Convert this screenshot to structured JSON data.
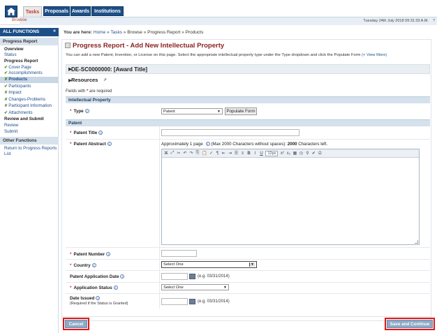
{
  "header": {
    "tabs": [
      {
        "label": "Tasks"
      },
      {
        "label": "Proposals"
      },
      {
        "label": "Awards"
      },
      {
        "label": "Institutions"
      }
    ],
    "subnav": "Browse",
    "date": "Tuesday 24th July 2018 09:31:33 A.M.",
    "help": "?"
  },
  "sidebar": {
    "title": "ALL FUNCTIONS",
    "collapse": "«",
    "section1": "Progress Report",
    "overview": "Overview",
    "status": "Status",
    "progress_report": "Progress Report",
    "items": [
      {
        "label": "Cover Page",
        "mark": "✔"
      },
      {
        "label": "Accomplishments",
        "mark": "✔"
      },
      {
        "label": "Products",
        "mark": "✘"
      },
      {
        "label": "Participants",
        "mark": "✔"
      },
      {
        "label": "Impact",
        "mark": "✘"
      },
      {
        "label": "Changes-Problems",
        "mark": "✘"
      },
      {
        "label": "Participant Information",
        "mark": "✘"
      },
      {
        "label": "Attachments",
        "mark": "✔"
      }
    ],
    "review_submit": "Review and Submit",
    "review": "Review",
    "submit": "Submit",
    "section2": "Other Functions",
    "other_items": [
      "Return to Progress Reports",
      "List"
    ]
  },
  "breadcrumb": {
    "prefix": "You are here:",
    "home": "Home",
    "tasks": "Tasks",
    "rest": "» Browse » Progress Report » Products",
    "sep": "»"
  },
  "page": {
    "title": "Progress Report - Add New Intellectual Property",
    "description": "You can add a new Patent, Invention, or License on this page. Select the appropriate intellectual property type under the Type dropdown and click the Populate Form",
    "view_more": "(+ View More)",
    "award": "DE-SC0000000: [Award Title]",
    "resources": "Resources",
    "required_note_pre": "Fields with",
    "required_note_post": "are required"
  },
  "form": {
    "section_ip": "Intellectual Property",
    "type_label": "Type",
    "type_value": "Patent",
    "populate_button": "Populate Form",
    "section_patent": "Patent",
    "patent_title_label": "Patent Title",
    "patent_title_value": "",
    "patent_abstract_label": "Patent Abstract",
    "abstract_note_pre": "Approximately 1 page",
    "abstract_note_mid": "(Max 2000 Characters without spaces):",
    "abstract_count": "2000",
    "abstract_note_post": "Characters left.",
    "editor_font_size": "12px",
    "patent_number_label": "Patent Number",
    "patent_number_value": "",
    "country_label": "Country",
    "country_value": "Select One",
    "app_date_label": "Patent Application Date",
    "app_date_hint": "(e.g. 03/31/2014)",
    "app_status_label": "Application Status",
    "app_status_value": "Select One",
    "date_issued_label": "Date Issued",
    "date_issued_sub": "(Required if the Status is Granted)",
    "date_issued_hint": "(e.g. 03/31/2014)"
  },
  "buttons": {
    "cancel": "Cancel",
    "save": "Save and Continue"
  },
  "colors": {
    "brand": "#1d4f87",
    "title": "#8a1e1e",
    "required": "#c0392b",
    "highlight": "#e01616"
  }
}
